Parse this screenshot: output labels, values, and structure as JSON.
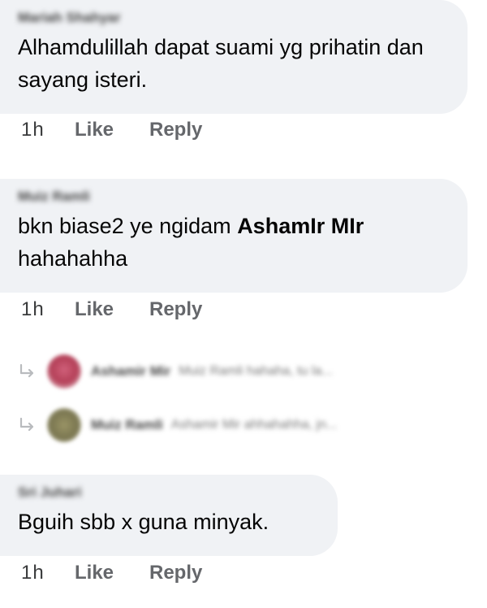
{
  "comments": [
    {
      "author": "Mariah Shahyar",
      "text": "Alhamdulillah dapat suami yg prihatin dan sayang isteri.",
      "time": "1h",
      "like_label": "Like",
      "reply_label": "Reply"
    },
    {
      "author": "Muiz Ramli",
      "text_before": "bkn biase2 ye ngidam",
      "mention": "AshamIr MIr",
      "text_after": "hahahahha",
      "time": "1h",
      "like_label": "Like",
      "reply_label": "Reply",
      "replies": [
        {
          "author": "Ashamir Mir",
          "snippet": "Muiz Ramli hahaha, tu la...",
          "avatar_color": "#c0506a"
        },
        {
          "author": "Muiz Ramli",
          "snippet": "Ashamir Mir ahhahahha, jn...",
          "avatar_color": "#8a8658"
        }
      ]
    },
    {
      "author": "Sri Juhari",
      "text": "Bguih sbb x guna minyak.",
      "time": "1h",
      "like_label": "Like",
      "reply_label": "Reply"
    }
  ]
}
